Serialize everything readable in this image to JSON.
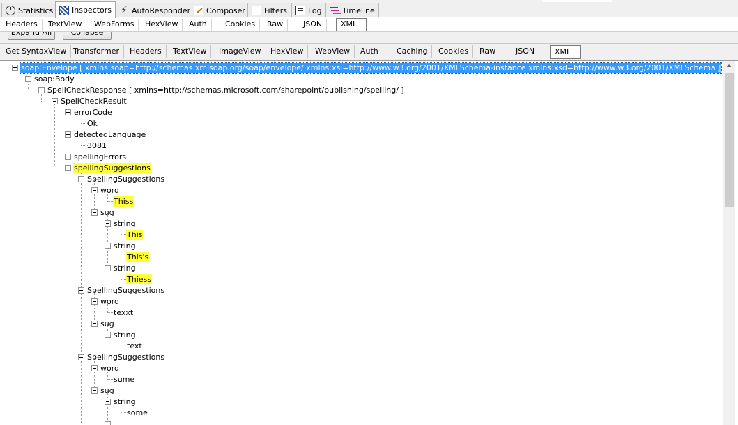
{
  "top_tabs": [
    {
      "label": "Statistics",
      "icon": "stopwatch-icon"
    },
    {
      "label": "Inspectors",
      "icon": "inspectors-icon",
      "active": true
    },
    {
      "label": "AutoResponder",
      "icon": "lightning-icon"
    },
    {
      "label": "Composer",
      "icon": "composer-icon"
    },
    {
      "label": "Filters",
      "icon": "filter-checkbox-icon"
    },
    {
      "label": "Log",
      "icon": "log-icon"
    },
    {
      "label": "Timeline",
      "icon": "timeline-icon"
    }
  ],
  "request_tabs": [
    "Headers",
    "TextView",
    "WebForms",
    "HexView",
    "Auth",
    "Cookies",
    "Raw",
    "JSON",
    "XML"
  ],
  "request_selected": "XML",
  "buttons": {
    "expand_all": "Expand All",
    "collapse": "Collapse"
  },
  "response_tabs": [
    "Get SyntaxView",
    "Transformer",
    "Headers",
    "TextView",
    "ImageView",
    "HexView",
    "WebView",
    "Auth",
    "Caching",
    "Cookies",
    "Raw",
    "JSON",
    "XML"
  ],
  "response_selected": "XML",
  "tree": {
    "root": "soap:Envelope [ xmlns:soap=http://schemas.xmlsoap.org/soap/envelope/ xmlns:xsi=http://www.w3.org/2001/XMLSchema-instance xmlns:xsd=http://www.w3.org/2001/XMLSchema ]",
    "body": "soap:Body",
    "response": "SpellCheckResponse [ xmlns=http://schemas.microsoft.com/sharepoint/publishing/spelling/ ]",
    "result": "SpellCheckResult",
    "error_code": "errorCode",
    "error_code_value": "Ok",
    "detected_language": "detectedLanguage",
    "detected_language_value": "3081",
    "spelling_errors": "spellingErrors",
    "spelling_suggestions": "spellingSuggestions",
    "groups": [
      {
        "label": "SpellingSuggestions",
        "word_label": "word",
        "word": "Thiss",
        "sug_label": "sug",
        "strings": [
          {
            "label": "string",
            "value": "This"
          },
          {
            "label": "string",
            "value": "This's"
          },
          {
            "label": "string",
            "value": "Thiess"
          }
        ]
      },
      {
        "label": "SpellingSuggestions",
        "word_label": "word",
        "word": "texxt",
        "sug_label": "sug",
        "strings": [
          {
            "label": "string",
            "value": "text"
          }
        ]
      },
      {
        "label": "SpellingSuggestions",
        "word_label": "word",
        "word": "sume",
        "sug_label": "sug",
        "strings": [
          {
            "label": "string",
            "value": "some"
          }
        ]
      }
    ]
  }
}
